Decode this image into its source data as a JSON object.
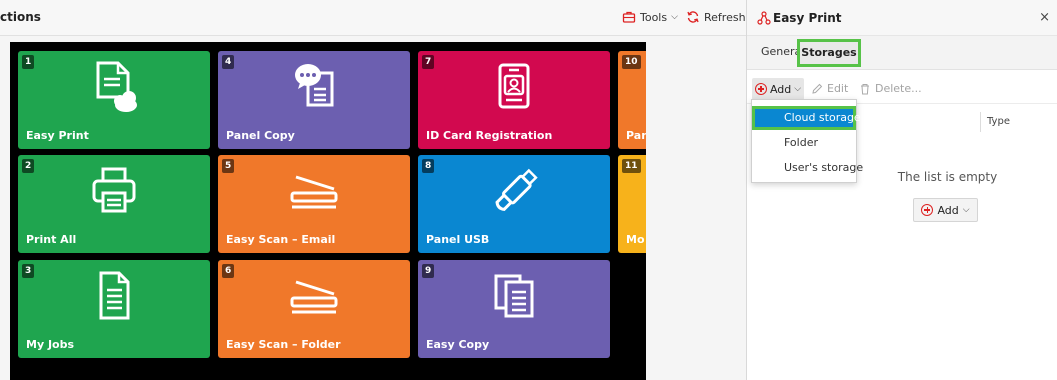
{
  "header": {
    "title": "ctions",
    "tools_label": "Tools",
    "refresh_label": "Refresh"
  },
  "tiles": [
    {
      "num": "1",
      "label": "Easy Print",
      "color": "#1fa54f",
      "icon": "cloud-document-icon"
    },
    {
      "num": "4",
      "label": "Panel Copy",
      "color": "#6c5fb0",
      "icon": "chat-document-icon"
    },
    {
      "num": "7",
      "label": "ID Card Registration",
      "color": "#d2094f",
      "icon": "id-card-icon"
    },
    {
      "num": "10",
      "label": "Pan",
      "color": "#f0782a",
      "icon": ""
    },
    {
      "num": "2",
      "label": "Print All",
      "color": "#1fa54f",
      "icon": "printer-icon"
    },
    {
      "num": "5",
      "label": "Easy Scan – Email",
      "color": "#f0782a",
      "icon": "scanner-icon"
    },
    {
      "num": "8",
      "label": "Panel USB",
      "color": "#0a87d1",
      "icon": "usb-icon"
    },
    {
      "num": "11",
      "label": "Mo",
      "color": "#f7b21b",
      "icon": ""
    },
    {
      "num": "3",
      "label": "My Jobs",
      "color": "#1fa54f",
      "icon": "document-icon"
    },
    {
      "num": "6",
      "label": "Easy Scan – Folder",
      "color": "#f0782a",
      "icon": "scanner-icon"
    },
    {
      "num": "9",
      "label": "Easy Copy",
      "color": "#6c5fb0",
      "icon": "copy-document-icon"
    }
  ],
  "panel": {
    "title": "Easy Print",
    "close": "×",
    "tabs": {
      "general": "General",
      "storages": "Storages"
    },
    "toolbar": {
      "add": "Add",
      "edit": "Edit",
      "delete": "Delete..."
    },
    "columns": {
      "type": "Type"
    },
    "empty": "The list is empty",
    "add_button": "Add"
  },
  "dropdown": {
    "items": [
      "Cloud storage",
      "Folder",
      "User's storage"
    ],
    "selected": "Cloud storage"
  },
  "colors": {
    "accent_green": "#57c248",
    "selected_blue": "#0a87d1",
    "add_red": "#dd2222"
  }
}
